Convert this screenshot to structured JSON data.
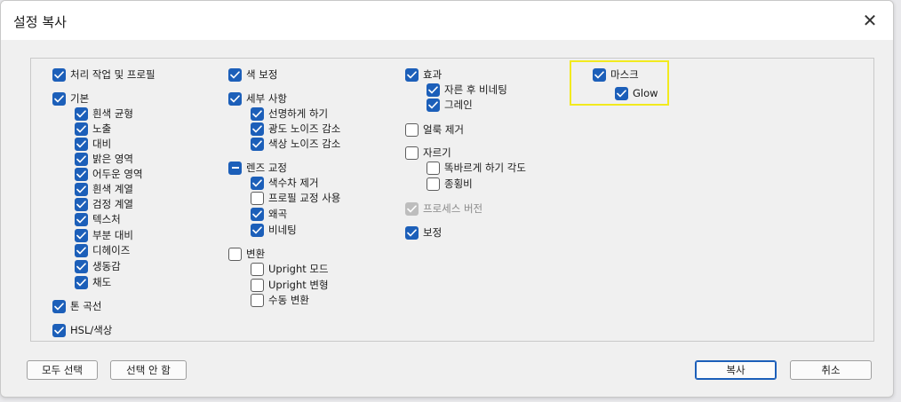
{
  "dialog": {
    "title": "설정 복사",
    "close_glyph": "✕"
  },
  "col1": {
    "processing": "처리 작업 및 프로필",
    "basic": "기본",
    "basic_items": [
      "흰색 균형",
      "노출",
      "대비",
      "밝은 영역",
      "어두운 영역",
      "흰색 계열",
      "검정 계열",
      "텍스처",
      "부분 대비",
      "디헤이즈",
      "생동감",
      "채도"
    ],
    "tone_curve": "톤 곡선",
    "hsl": "HSL/색상"
  },
  "col2": {
    "color_grading": "색 보정",
    "detail": "세부 사항",
    "detail_items": [
      "선명하게 하기",
      "광도 노이즈 감소",
      "색상 노이즈 감소"
    ],
    "lens": "렌즈 교정",
    "lens_items": [
      "색수차 제거",
      "프로필 교정 사용",
      "왜곡",
      "비네팅"
    ],
    "transform": "변환",
    "transform_items": [
      "Upright 모드",
      "Upright 변형",
      "수동 변환"
    ]
  },
  "col3": {
    "effects": "효과",
    "effects_items": [
      "자른 후 비네팅",
      "그레인"
    ],
    "spot_removal": "얼룩 제거",
    "crop": "자르기",
    "crop_items": [
      "똑바르게 하기 각도",
      "종횡비"
    ],
    "process_version": "프로세스 버전",
    "calibration": "보정"
  },
  "col4": {
    "mask": "마스크",
    "glow": "Glow"
  },
  "buttons": {
    "select_all": "모두 선택",
    "select_none": "선택 안 함",
    "copy": "복사",
    "cancel": "취소"
  },
  "colors": {
    "accent": "#1c5fb9",
    "highlight": "#f2ea1e"
  }
}
